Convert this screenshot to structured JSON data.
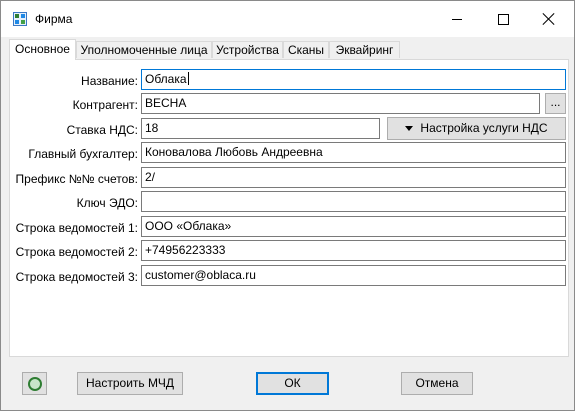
{
  "window": {
    "title": "Фирма",
    "icon": "firm-app-icon"
  },
  "tabs": [
    {
      "label": "Основное",
      "active": true
    },
    {
      "label": "Уполномоченные лица"
    },
    {
      "label": "Устройства"
    },
    {
      "label": "Сканы"
    },
    {
      "label": "Эквайринг"
    }
  ],
  "form": {
    "name_label": "Название:",
    "name_value": "Облака",
    "contractor_label": "Контрагент:",
    "contractor_value": "ВЕСНА",
    "contractor_browse": "...",
    "vat_label": "Ставка НДС:",
    "vat_value": "18",
    "vat_button": "Настройка услуги НДС",
    "accountant_label": "Главный бухгалтер:",
    "accountant_value": "Коновалова Любовь Андреевна",
    "prefix_label": "Префикс №№ счетов:",
    "prefix_value": "2/",
    "edo_label": "Ключ ЭДО:",
    "edo_value": "",
    "line1_label": "Строка ведомостей 1:",
    "line1_value": "ООО «Облака»",
    "line2_label": "Строка ведомостей 2:",
    "line2_value": "+74956223333",
    "line3_label": "Строка ведомостей 3:",
    "line3_value": "customer@oblaca.ru"
  },
  "footer": {
    "mchd_button": "Настроить МЧД",
    "ok_button": "ОК",
    "cancel_button": "Отмена",
    "icon": "refresh-icon"
  }
}
